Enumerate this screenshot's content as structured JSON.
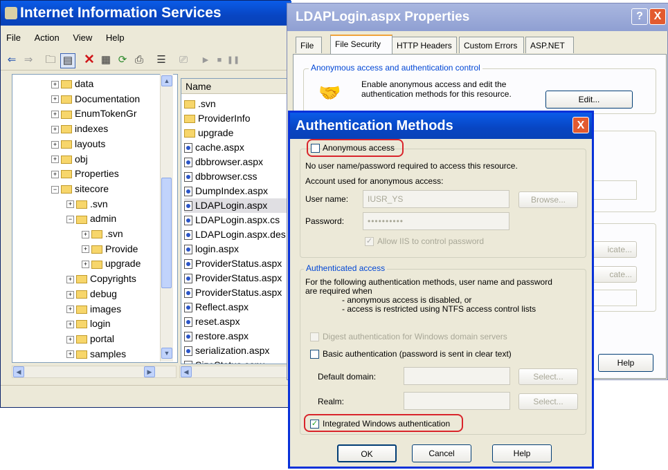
{
  "iis": {
    "title": "Internet Information Services",
    "menu": [
      "File",
      "Action",
      "View",
      "Help"
    ],
    "toolbar_icons": [
      "back-icon",
      "forward-icon",
      "up-folder-icon",
      "show-tree-icon",
      "delete-icon",
      "properties-icon",
      "refresh-icon",
      "export-icon",
      "help-icon",
      "computer-icon",
      "play-icon",
      "stop-icon",
      "pause-icon"
    ],
    "tree": [
      {
        "label": "data",
        "indent": 0,
        "exp": "+"
      },
      {
        "label": "Documentation",
        "indent": 0,
        "exp": "+"
      },
      {
        "label": "EnumTokenGr",
        "indent": 0,
        "exp": "+"
      },
      {
        "label": "indexes",
        "indent": 0,
        "exp": "+"
      },
      {
        "label": "layouts",
        "indent": 0,
        "exp": "+"
      },
      {
        "label": "obj",
        "indent": 0,
        "exp": "+"
      },
      {
        "label": "Properties",
        "indent": 0,
        "exp": "+"
      },
      {
        "label": "sitecore",
        "indent": 0,
        "exp": "−"
      },
      {
        "label": ".svn",
        "indent": 1,
        "exp": "+"
      },
      {
        "label": "admin",
        "indent": 1,
        "exp": "−"
      },
      {
        "label": ".svn",
        "indent": 2,
        "exp": "+"
      },
      {
        "label": "Provide",
        "indent": 2,
        "exp": "+"
      },
      {
        "label": "upgrade",
        "indent": 2,
        "exp": "+"
      },
      {
        "label": "Copyrights",
        "indent": 1,
        "exp": "+"
      },
      {
        "label": "debug",
        "indent": 1,
        "exp": "+"
      },
      {
        "label": "images",
        "indent": 1,
        "exp": "+"
      },
      {
        "label": "login",
        "indent": 1,
        "exp": "+"
      },
      {
        "label": "portal",
        "indent": 1,
        "exp": "+"
      },
      {
        "label": "samples",
        "indent": 1,
        "exp": "+"
      }
    ],
    "list_header": "Name",
    "list": [
      {
        "label": ".svn",
        "kind": "folder"
      },
      {
        "label": "ProviderInfo",
        "kind": "folder"
      },
      {
        "label": "upgrade",
        "kind": "folder"
      },
      {
        "label": "cache.aspx",
        "kind": "file"
      },
      {
        "label": "dbbrowser.aspx",
        "kind": "file"
      },
      {
        "label": "dbbrowser.css",
        "kind": "file"
      },
      {
        "label": "DumpIndex.aspx",
        "kind": "file"
      },
      {
        "label": "LDAPLogin.aspx",
        "kind": "file",
        "selected": true
      },
      {
        "label": "LDAPLogin.aspx.cs",
        "kind": "file"
      },
      {
        "label": "LDAPLogin.aspx.des",
        "kind": "file"
      },
      {
        "label": "login.aspx",
        "kind": "file"
      },
      {
        "label": "ProviderStatus.aspx",
        "kind": "file"
      },
      {
        "label": "ProviderStatus.aspx",
        "kind": "file"
      },
      {
        "label": "ProviderStatus.aspx",
        "kind": "file"
      },
      {
        "label": "Reflect.aspx",
        "kind": "file"
      },
      {
        "label": "reset.aspx",
        "kind": "file"
      },
      {
        "label": "restore.aspx",
        "kind": "file"
      },
      {
        "label": "serialization.aspx",
        "kind": "file"
      },
      {
        "label": "SizeStatus.aspx",
        "kind": "file"
      }
    ]
  },
  "props": {
    "title": "LDAPLogin.aspx Properties",
    "help_btn": "?",
    "close_btn": "X",
    "tabs": [
      "File",
      "File Security",
      "HTTP Headers",
      "Custom Errors",
      "ASP.NET"
    ],
    "active_tab": "File Security",
    "anon_group": "Anonymous access and authentication control",
    "anon_text": "Enable anonymous access and edit the authentication methods for this resource.",
    "edit_btn": "Edit...",
    "cert_btn1": "icate...",
    "cert_btn2": "cate...",
    "help_footer": "Help"
  },
  "auth": {
    "title": "Authentication Methods",
    "close": "X",
    "anon_label": "Anonymous access",
    "anon_checked": false,
    "anon_desc": "No user name/password required to access this resource.",
    "account_label": "Account used for anonymous access:",
    "username_label": "User name:",
    "username_value": "IUSR_YS",
    "browse_btn": "Browse...",
    "password_label": "Password:",
    "password_value": "••••••••••",
    "allow_iis": "Allow IIS to control password",
    "authenticated_group": "Authenticated access",
    "auth_desc1": "For the following authentication methods, user name and password",
    "auth_desc2": "are required when",
    "auth_bullet1": "- anonymous access is disabled, or",
    "auth_bullet2": "- access is restricted using NTFS access control lists",
    "digest": "Digest authentication for Windows domain servers",
    "basic": "Basic authentication (password is sent in clear text)",
    "default_domain": "Default domain:",
    "realm": "Realm:",
    "select1": "Select...",
    "select2": "Select...",
    "integrated": "Integrated Windows authentication",
    "integrated_checked": true,
    "ok": "OK",
    "cancel": "Cancel",
    "help": "Help"
  }
}
